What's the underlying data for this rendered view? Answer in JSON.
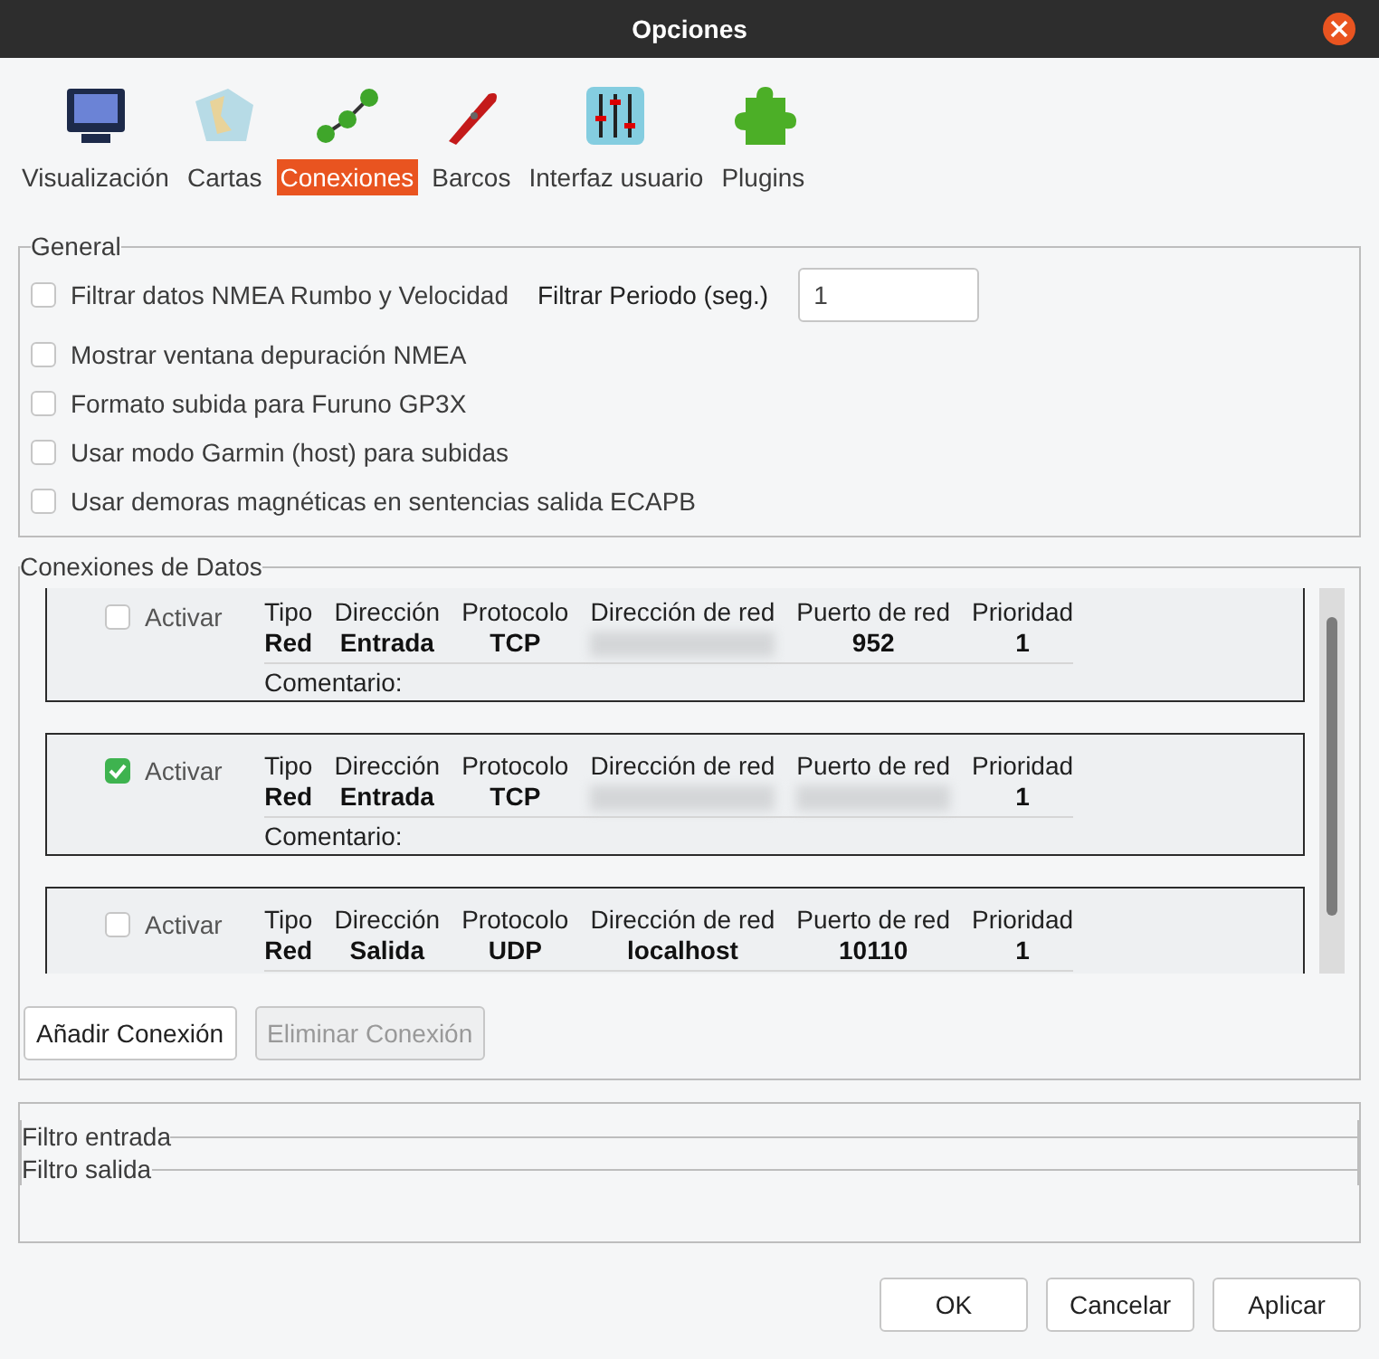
{
  "window": {
    "title": "Opciones"
  },
  "tabs": [
    {
      "label": "Visualización",
      "kind": "monitor",
      "selected": false
    },
    {
      "label": "Cartas",
      "kind": "charts",
      "selected": false
    },
    {
      "label": "Conexiones",
      "kind": "connections",
      "selected": true
    },
    {
      "label": "Barcos",
      "kind": "boat",
      "selected": false
    },
    {
      "label": "Interfaz usuario",
      "kind": "sliders",
      "selected": false
    },
    {
      "label": "Plugins",
      "kind": "puzzle",
      "selected": false
    }
  ],
  "general": {
    "title": "General",
    "nmea_filter": {
      "label": "Filtrar datos NMEA Rumbo y Velocidad",
      "checked": false
    },
    "period": {
      "label": "Filtrar Periodo (seg.)",
      "value": "1"
    },
    "options": [
      {
        "label": "Mostrar ventana depuración NMEA",
        "checked": false
      },
      {
        "label": "Formato subida para Furuno GP3X",
        "checked": false
      },
      {
        "label": "Usar modo Garmin (host) para subidas",
        "checked": false
      },
      {
        "label": "Usar demoras magnéticas en sentencias salida ECAPB",
        "checked": false
      }
    ]
  },
  "data_connections": {
    "title": "Conexiones de Datos",
    "connections": [
      {
        "enabled": false,
        "enable_label": "Activar",
        "fields": [
          {
            "label": "Tipo",
            "value": "Red"
          },
          {
            "label": "Dirección",
            "value": "Entrada"
          },
          {
            "label": "Protocolo",
            "value": "TCP"
          },
          {
            "label": "Dirección de red",
            "blurred": true
          },
          {
            "label": "Puerto de red",
            "value": "952"
          },
          {
            "label": "Prioridad",
            "value": "1"
          }
        ],
        "comment_label": "Comentario:"
      },
      {
        "enabled": true,
        "enable_label": "Activar",
        "fields": [
          {
            "label": "Tipo",
            "value": "Red"
          },
          {
            "label": "Dirección",
            "value": "Entrada"
          },
          {
            "label": "Protocolo",
            "value": "TCP"
          },
          {
            "label": "Dirección de red",
            "blurred": true
          },
          {
            "label": "Puerto de red",
            "blurred": true
          },
          {
            "label": "Prioridad",
            "value": "1"
          }
        ],
        "comment_label": "Comentario:"
      },
      {
        "enabled": false,
        "enable_label": "Activar",
        "fields": [
          {
            "label": "Tipo",
            "value": "Red"
          },
          {
            "label": "Dirección",
            "value": "Salida"
          },
          {
            "label": "Protocolo",
            "value": "UDP"
          },
          {
            "label": "Dirección de red",
            "value": "localhost"
          },
          {
            "label": "Puerto de red",
            "value": "10110"
          },
          {
            "label": "Prioridad",
            "value": "1"
          }
        ]
      }
    ],
    "buttons": [
      {
        "label": "Añadir Conexión",
        "disabled": false
      },
      {
        "label": "Eliminar Conexión",
        "disabled": true
      }
    ]
  },
  "filters": [
    "Filtro entrada",
    "Filtro salida"
  ],
  "dialog_buttons": [
    "OK",
    "Cancelar",
    "Aplicar"
  ]
}
